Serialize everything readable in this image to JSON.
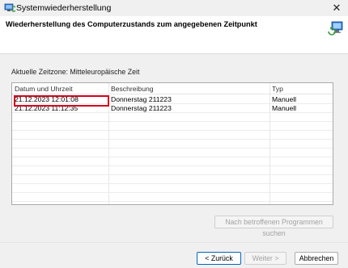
{
  "window": {
    "title": "Systemwiederherstellung",
    "close_glyph": "✕"
  },
  "header": {
    "heading": "Wiederherstellung des Computerzustands zum angegebenen Zeitpunkt"
  },
  "timezone_label": "Aktuelle Zeitzone: Mitteleuropäische Zeit",
  "restore_points": {
    "columns": [
      "Datum und Uhrzeit",
      "Beschreibung",
      "Typ"
    ],
    "rows": [
      [
        "21.12.2023 12:01:08",
        "Donnerstag 211223",
        "Manuell"
      ],
      [
        "21.12.2023 11:12:35",
        "Donnerstag 211223",
        "Manuell"
      ]
    ],
    "highlight_color": "#d6001c"
  },
  "buttons": {
    "affected_programs": "Nach betroffenen Programmen suchen",
    "back": "< Zurück",
    "next": "Weiter >",
    "cancel": "Abbrechen"
  },
  "icons": {
    "app": "system-restore-icon",
    "header": "restore-wizard-icon"
  }
}
